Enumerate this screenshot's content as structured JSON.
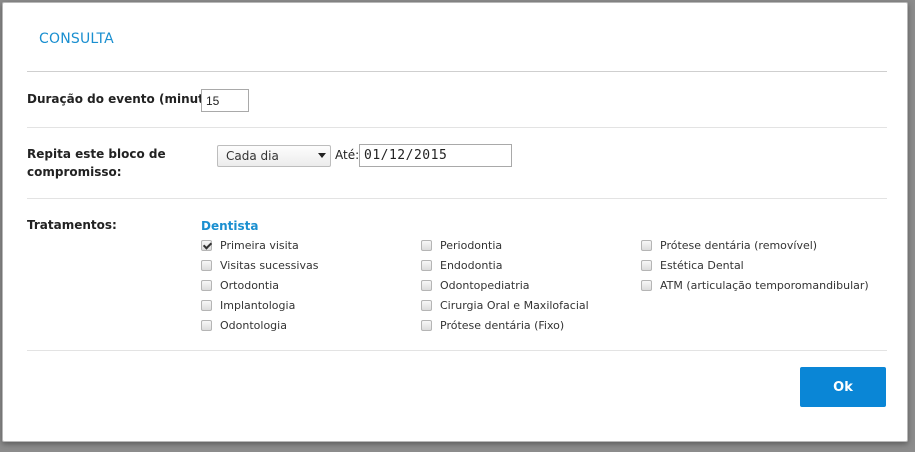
{
  "dialog": {
    "title": "CONSULTA",
    "duration": {
      "label": "Duração do evento (minutos):",
      "value": "15"
    },
    "repeat": {
      "label_line1": "Repita este bloco de",
      "label_line2": "compromisso:",
      "frequency_selected": "Cada dia",
      "until_label": "Até:",
      "until_value": "01/12/2015"
    },
    "treatments": {
      "label": "Tratamentos:",
      "group_title": "Dentista",
      "columns": [
        [
          {
            "label": "Primeira visita",
            "checked": true
          },
          {
            "label": "Visitas sucessivas",
            "checked": false
          },
          {
            "label": "Ortodontia",
            "checked": false
          },
          {
            "label": "Implantologia",
            "checked": false
          },
          {
            "label": "Odontologia",
            "checked": false
          }
        ],
        [
          {
            "label": "Periodontia",
            "checked": false
          },
          {
            "label": "Endodontia",
            "checked": false
          },
          {
            "label": "Odontopediatria",
            "checked": false
          },
          {
            "label": "Cirurgia Oral e Maxilofacial",
            "checked": false
          },
          {
            "label": "Prótese dentária (Fixo)",
            "checked": false
          }
        ],
        [
          {
            "label": "Prótese dentária (removível)",
            "checked": false
          },
          {
            "label": "Estética Dental",
            "checked": false
          },
          {
            "label": "ATM (articulação temporomandibular)",
            "checked": false
          }
        ]
      ]
    },
    "ok_label": "Ok"
  },
  "colors": {
    "accent": "#1a8fd0",
    "button": "#0a86d6"
  }
}
